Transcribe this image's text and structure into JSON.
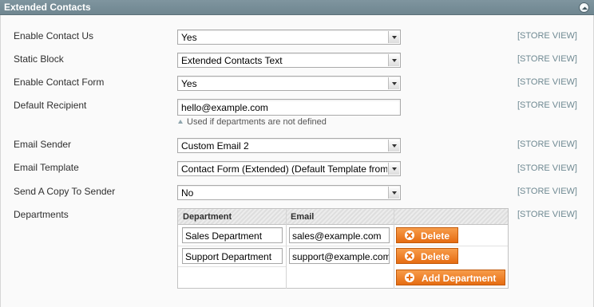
{
  "section": {
    "title": "Extended Contacts"
  },
  "scope_label": "[STORE VIEW]",
  "fields": {
    "enable_contact_us": {
      "label": "Enable Contact Us",
      "value": "Yes"
    },
    "static_block": {
      "label": "Static Block",
      "value": "Extended Contacts Text"
    },
    "enable_contact_form": {
      "label": "Enable Contact Form",
      "value": "Yes"
    },
    "default_recipient": {
      "label": "Default Recipient",
      "value": "hello@example.com",
      "note": "Used if departments are not defined"
    },
    "email_sender": {
      "label": "Email Sender",
      "value": "Custom Email 2"
    },
    "email_template": {
      "label": "Email Template",
      "value": "Contact Form (Extended) (Default Template from"
    },
    "send_copy": {
      "label": "Send A Copy To Sender",
      "value": "No"
    },
    "departments": {
      "label": "Departments"
    }
  },
  "departments_grid": {
    "headers": {
      "department": "Department",
      "email": "Email"
    },
    "rows": [
      {
        "department": "Sales Department",
        "email": "sales@example.com",
        "delete_label": "Delete"
      },
      {
        "department": "Support Department",
        "email": "support@example.com",
        "delete_label": "Delete"
      }
    ],
    "add_label": "Add Department"
  },
  "colors": {
    "header_bg": "#7f959f",
    "scope_text": "#6f8992",
    "button_orange": "#e66c12"
  },
  "icons": {
    "collapse": "collapse-up-icon",
    "delete": "delete-x-icon",
    "add": "add-plus-icon",
    "note": "note-triangle-icon"
  }
}
